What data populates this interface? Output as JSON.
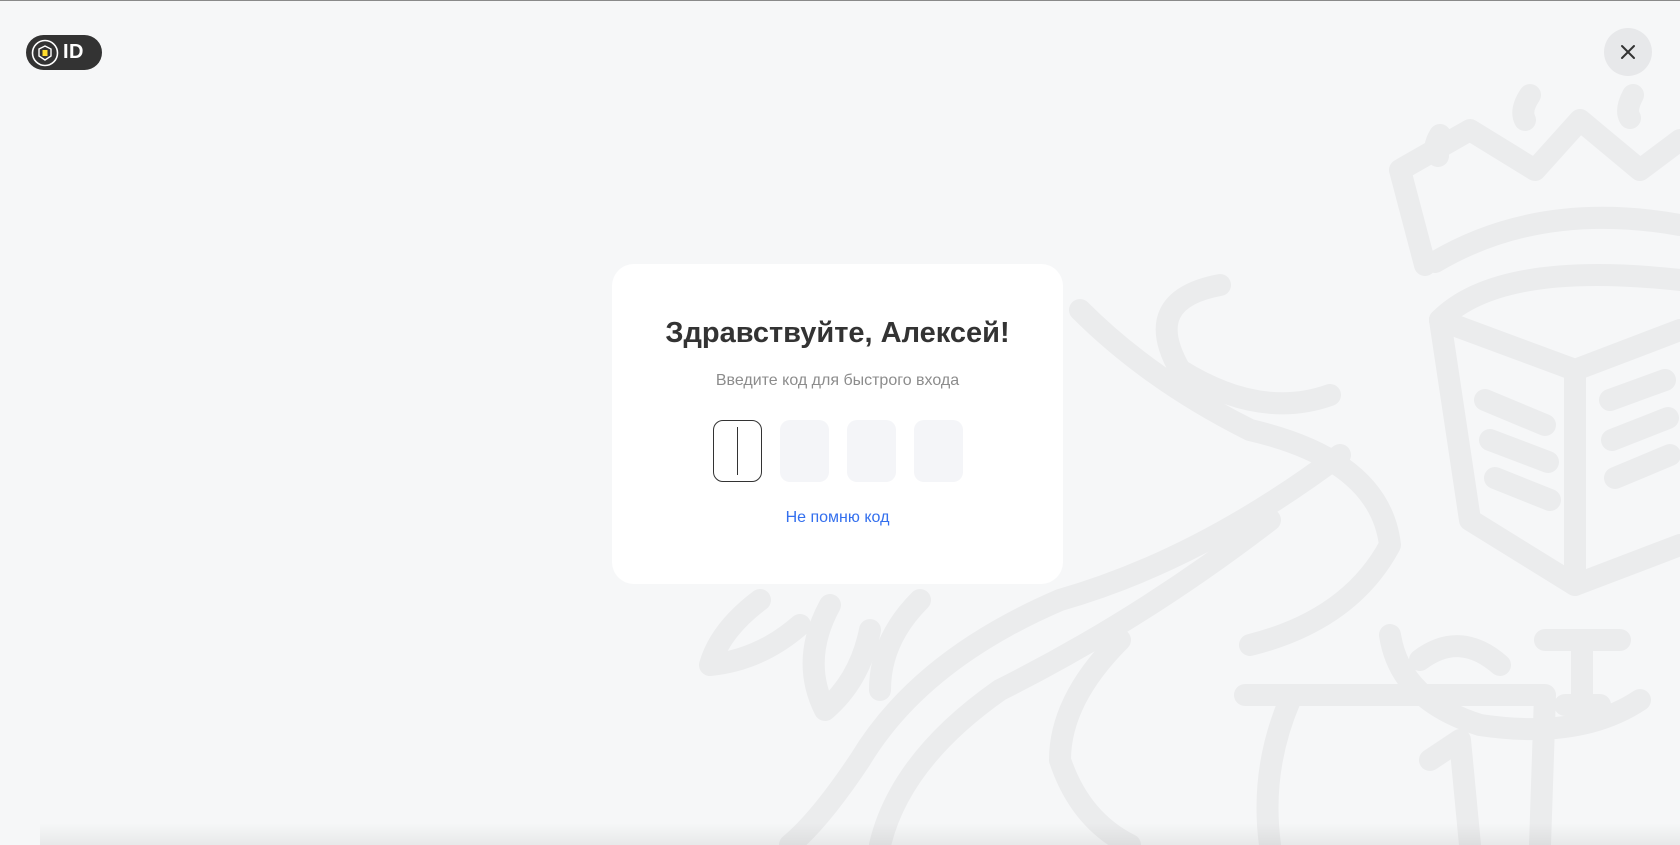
{
  "header": {
    "logo_text": "ID",
    "logo_emblem_icon": "coat-of-arms-icon",
    "close_icon": "close-icon"
  },
  "auth": {
    "title": "Здравствуйте, Алексей!",
    "subtitle": "Введите код для быстрого входа",
    "code_cells": [
      "",
      "",
      "",
      ""
    ],
    "active_cell_index": 0,
    "forgot_link": "Не помню код"
  },
  "colors": {
    "background": "#f6f7f8",
    "card": "#ffffff",
    "title": "#333333",
    "subtitle": "#8c8c8c",
    "link": "#336fee",
    "logo_bg": "#333333",
    "emblem_watermark": "#ebeced",
    "logo_accent": "#ffdd2d"
  },
  "background_icon": "coat-of-arms-watermark-icon"
}
